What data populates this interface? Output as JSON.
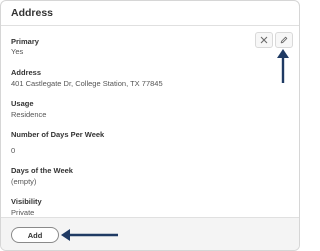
{
  "section": {
    "title": "Address"
  },
  "fields": [
    {
      "label": "Primary",
      "value": "Yes"
    },
    {
      "label": "Address",
      "value": "401 Castlegate Dr, College Station, TX 77845"
    },
    {
      "label": "Usage",
      "value": "Residence"
    },
    {
      "label": "Number of Days Per Week",
      "value": "0"
    },
    {
      "label": "Days of the Week",
      "value": "(empty)"
    },
    {
      "label": "Visibility",
      "value": "Private"
    }
  ],
  "actions": {
    "remove_icon": "close-icon",
    "edit_icon": "pencil-icon",
    "add_label": "Add"
  },
  "colors": {
    "arrow": "#1f3a63",
    "border": "#d6d6d6",
    "footer_bg": "#f4f4f4"
  }
}
